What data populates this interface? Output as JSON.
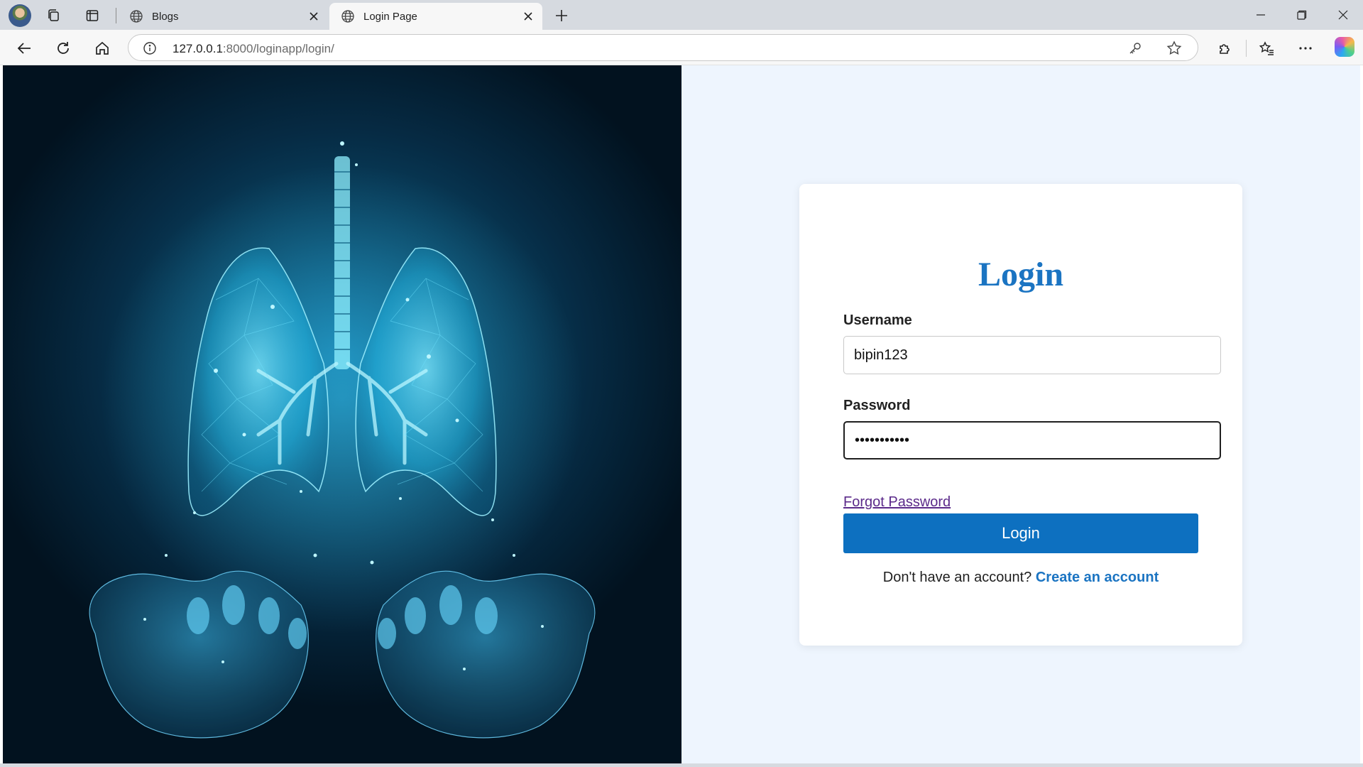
{
  "browser": {
    "tabs": [
      {
        "title": "Blogs",
        "active": false
      },
      {
        "title": "Login Page",
        "active": true
      }
    ],
    "address": {
      "url_host": "127.0.0.1",
      "url_rest": ":8000/loginapp/login/"
    }
  },
  "page": {
    "title": "Login",
    "username": {
      "label": "Username",
      "value": "bipin123"
    },
    "password": {
      "label": "Password",
      "value": "•••••••••••"
    },
    "forgot_link": "Forgot Password",
    "submit_label": "Login",
    "signup_prompt": "Don't have an account?",
    "signup_link": "Create an account"
  },
  "colors": {
    "accent": "#1b74c2",
    "button": "#0d70c0",
    "page_background": "#eef5fe",
    "visited_link": "#5b2a8a"
  }
}
